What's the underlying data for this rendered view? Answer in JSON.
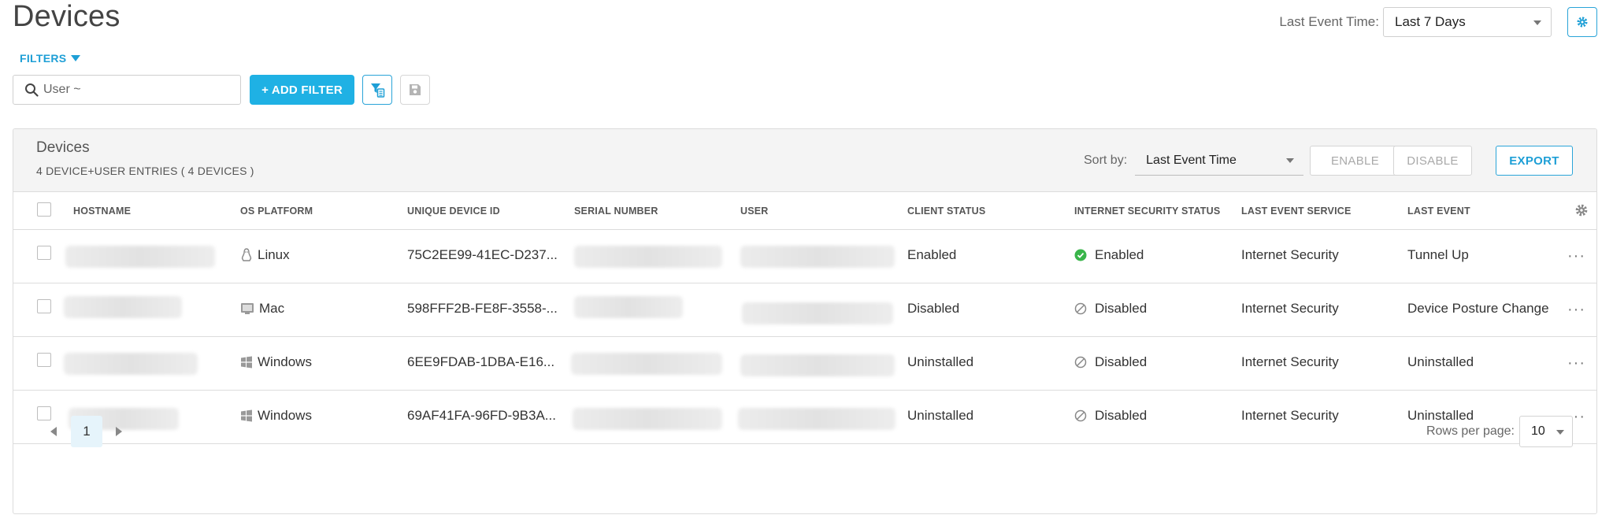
{
  "page": {
    "title": "Devices"
  },
  "time_filter": {
    "label": "Last Event Time:",
    "value": "Last 7 Days"
  },
  "filters": {
    "toggle_label": "FILTERS",
    "search_placeholder": "User ~",
    "add_filter_label": "+ ADD FILTER"
  },
  "panel": {
    "title": "Devices",
    "subtitle": "4 DEVICE+USER ENTRIES ( 4 DEVICES )",
    "sort_label": "Sort by:",
    "sort_value": "Last Event Time",
    "enable_label": "ENABLE",
    "disable_label": "DISABLE",
    "export_label": "EXPORT"
  },
  "table": {
    "columns": {
      "hostname": "HOSTNAME",
      "os_platform": "OS PLATFORM",
      "unique_device_id": "UNIQUE DEVICE ID",
      "serial_number": "SERIAL NUMBER",
      "user": "USER",
      "client_status": "CLIENT STATUS",
      "internet_security_status": "INTERNET SECURITY STATUS",
      "last_event_service": "LAST EVENT SERVICE",
      "last_event": "LAST EVENT"
    },
    "rows": [
      {
        "os": "Linux",
        "os_icon": "linux-icon",
        "device_id": "75C2EE99-41EC-D237...",
        "client_status": "Enabled",
        "security_status": "Enabled",
        "security_icon": "check-circle-icon",
        "service": "Internet Security",
        "last_event": "Tunnel Up"
      },
      {
        "os": "Mac",
        "os_icon": "mac-icon",
        "device_id": "598FFF2B-FE8F-3558-...",
        "client_status": "Disabled",
        "security_status": "Disabled",
        "security_icon": "disabled-circle-icon",
        "service": "Internet Security",
        "last_event": "Device Posture Change"
      },
      {
        "os": "Windows",
        "os_icon": "windows-icon",
        "device_id": "6EE9FDAB-1DBA-E16...",
        "client_status": "Uninstalled",
        "security_status": "Disabled",
        "security_icon": "disabled-circle-icon",
        "service": "Internet Security",
        "last_event": "Uninstalled"
      },
      {
        "os": "Windows",
        "os_icon": "windows-icon",
        "device_id": "69AF41FA-96FD-9B3A...",
        "client_status": "Uninstalled",
        "security_status": "Disabled",
        "security_icon": "disabled-circle-icon",
        "service": "Internet Security",
        "last_event": "Uninstalled"
      }
    ]
  },
  "pagination": {
    "current_page": "1",
    "rows_per_page_label": "Rows per page:",
    "rows_per_page": "10"
  },
  "colors": {
    "accent": "#1fb1e4",
    "enabled_green": "#39b54a",
    "disabled_gray": "#888888"
  }
}
